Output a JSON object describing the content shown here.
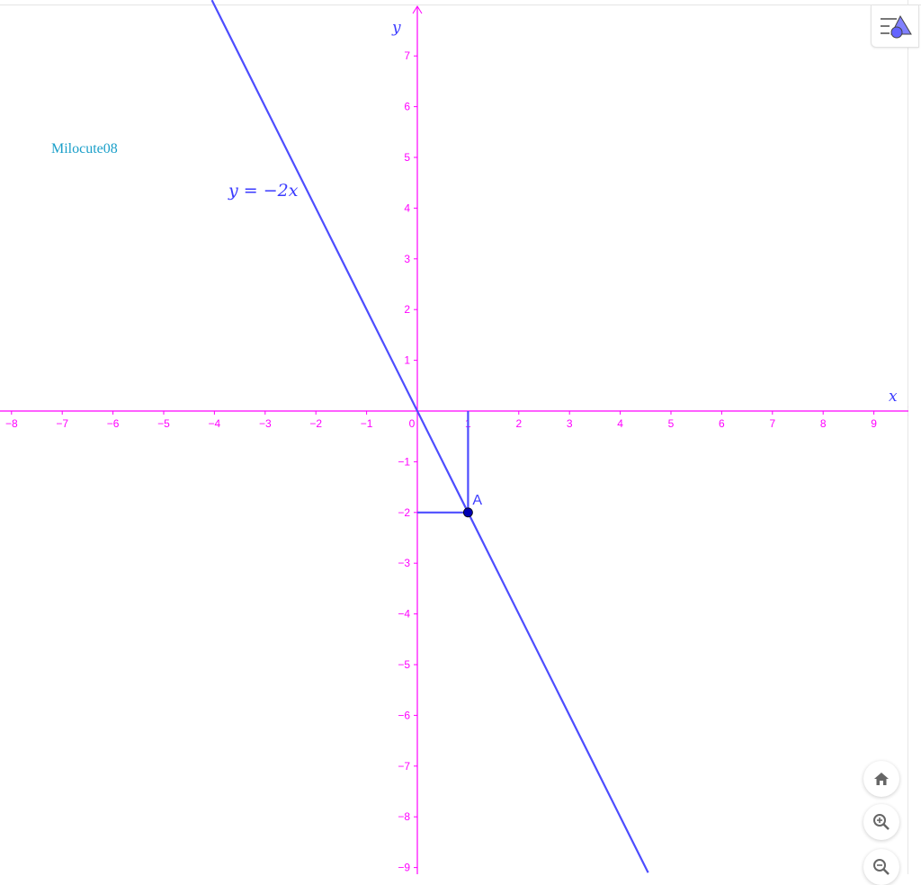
{
  "watermark": "Milocute08",
  "chart_data": {
    "type": "line",
    "title": "",
    "xlabel": "x",
    "ylabel": "y",
    "xlim": [
      -8.2,
      9.6
    ],
    "ylim": [
      -9.1,
      8.1
    ],
    "x_ticks": [
      -8,
      -7,
      -6,
      -5,
      -4,
      -3,
      -2,
      -1,
      0,
      1,
      2,
      3,
      4,
      5,
      6,
      7,
      8,
      9
    ],
    "y_ticks": [
      -9,
      -8,
      -7,
      -6,
      -5,
      -4,
      -3,
      -2,
      -1,
      1,
      2,
      3,
      4,
      5,
      6,
      7
    ],
    "grid": false,
    "series": [
      {
        "name": "y = -2x",
        "slope": -2,
        "intercept": 0,
        "label": "y = −2x",
        "color": "#4d4dff"
      }
    ],
    "points": [
      {
        "name": "A",
        "x": 1,
        "y": -2,
        "color": "#0000b3"
      }
    ],
    "guides": [
      {
        "from": [
          1,
          0
        ],
        "to": [
          1,
          -2
        ]
      },
      {
        "from": [
          0,
          -2
        ],
        "to": [
          1,
          -2
        ]
      }
    ],
    "axis_color": "#ff00ff"
  },
  "controls": {
    "style_bar": "style-bar-toggle",
    "home": "home-icon",
    "zoom_in": "zoom-in-icon",
    "zoom_out": "zoom-out-icon"
  }
}
